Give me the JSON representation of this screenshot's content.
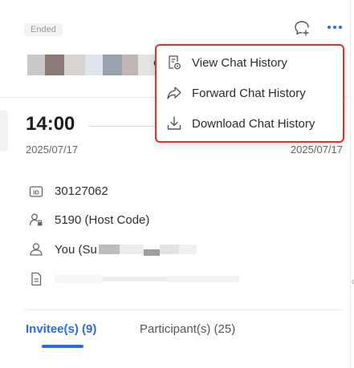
{
  "meeting": {
    "status_badge": "Ended",
    "start_time": "14:00",
    "start_date": "2025/07/17",
    "end_date": "2025/07/17",
    "meeting_id": "30127062",
    "host_code": "5190 (Host Code)",
    "organizer": "You (Su",
    "name_tail_char": "e",
    "description_tail_char": "ₒ"
  },
  "menu": {
    "items": [
      {
        "label": "View Chat History",
        "icon": "view-history-icon"
      },
      {
        "label": "Forward Chat History",
        "icon": "forward-icon"
      },
      {
        "label": "Download Chat History",
        "icon": "download-icon"
      }
    ],
    "highlight_color": "#e0322a"
  },
  "tabs": [
    {
      "label": "Invitee(s) (9)",
      "active": true
    },
    {
      "label": "Participant(s) (25)",
      "active": false
    }
  ],
  "colors": {
    "accent": "#2b6be6",
    "badge_bg": "#f2f3f5",
    "menu_border": "#e0322a"
  }
}
